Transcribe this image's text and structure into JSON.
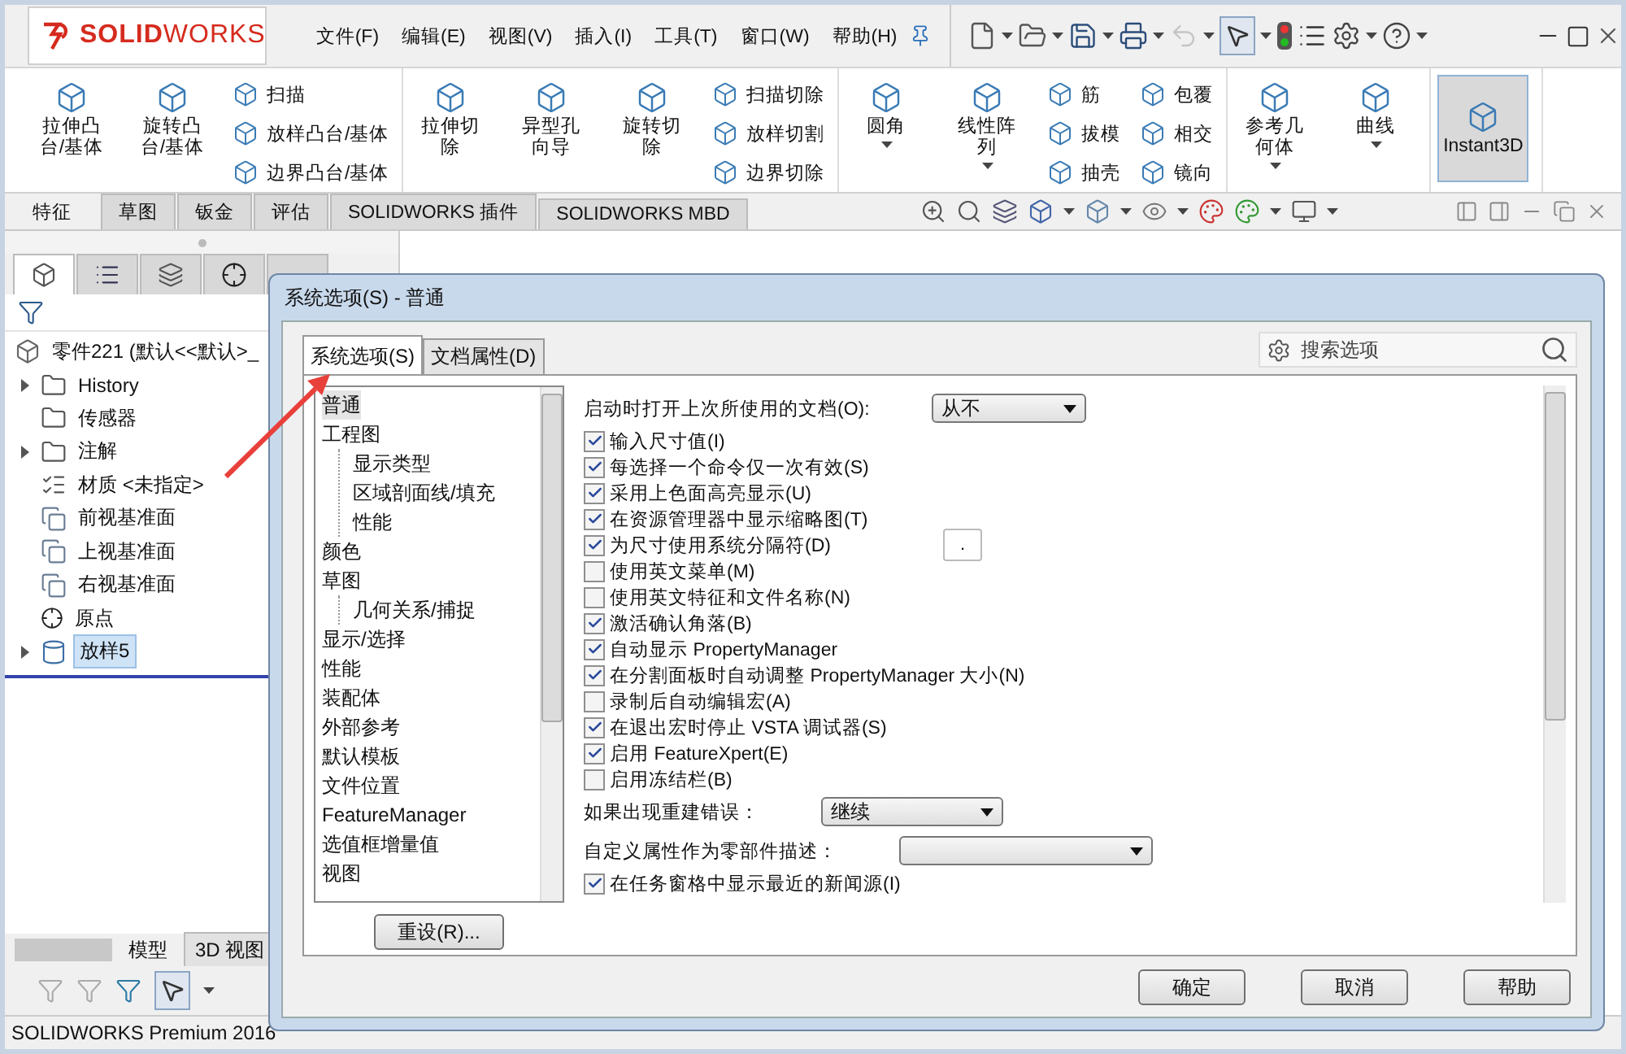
{
  "app": {
    "logo": "**SOLID**WORKS",
    "status": "SOLIDWORKS Premium 2016"
  },
  "menu": [
    "文件(F)",
    "编辑(E)",
    "视图(V)",
    "插入(I)",
    "工具(T)",
    "窗口(W)",
    "帮助(H)"
  ],
  "quick_toolbar": {
    "undo_disabled": true,
    "select_pressed": true
  },
  "ribbon": [
    {
      "big": [
        {
          "label": "拉伸凸台/基体",
          "dropdown": false,
          "pressed": false
        },
        {
          "label": "旋转凸台/基体",
          "dropdown": false,
          "pressed": false
        }
      ],
      "small_columns": [
        [
          "扫描",
          "放样凸台/基体",
          "边界凸台/基体"
        ]
      ]
    },
    {
      "big": [
        {
          "label": "拉伸切除",
          "dropdown": false,
          "pressed": false
        },
        {
          "label": "异型孔向导",
          "dropdown": false,
          "pressed": false
        },
        {
          "label": "旋转切除",
          "dropdown": false,
          "pressed": false
        }
      ],
      "small_columns": [
        [
          "扫描切除",
          "放样切割",
          "边界切除"
        ]
      ]
    },
    {
      "big": [
        {
          "label": "圆角",
          "dropdown": true,
          "pressed": false
        },
        {
          "label": "线性阵列",
          "dropdown": true,
          "pressed": false
        }
      ],
      "small_columns": [
        [
          "筋",
          "拔模",
          "抽壳"
        ],
        [
          "包覆",
          "相交",
          "镜向"
        ]
      ]
    },
    {
      "big": [
        {
          "label": "参考几何体",
          "dropdown": true,
          "pressed": false
        },
        {
          "label": "曲线",
          "dropdown": true,
          "pressed": false
        }
      ]
    },
    {
      "big": [
        {
          "label": "Instant3D",
          "dropdown": false,
          "pressed": true
        }
      ]
    }
  ],
  "command_tabs": [
    {
      "label": "特征",
      "selected": true
    },
    {
      "label": "草图",
      "selected": false
    },
    {
      "label": "钣金",
      "selected": false
    },
    {
      "label": "评估",
      "selected": false
    },
    {
      "label": "SOLIDWORKS 插件",
      "selected": false
    },
    {
      "label": "SOLIDWORKS MBD",
      "selected": false
    }
  ],
  "panel_tabs": [
    {
      "selected": true
    },
    {
      "selected": false
    },
    {
      "selected": false
    },
    {
      "selected": false
    },
    {
      "selected": false
    }
  ],
  "tree": {
    "label": "零件221  (默认<<默认>_",
    "kind": "part",
    "children": [
      {
        "label": "History",
        "kind": "history",
        "expandable": true,
        "selected": false
      },
      {
        "label": "传感器",
        "kind": "sensor",
        "expandable": false,
        "selected": false
      },
      {
        "label": "注解",
        "kind": "annotation",
        "expandable": true,
        "selected": false
      },
      {
        "label": "材质 <未指定>",
        "kind": "material",
        "expandable": false,
        "selected": false
      },
      {
        "label": "前视基准面",
        "kind": "plane",
        "expandable": false,
        "selected": false
      },
      {
        "label": "上视基准面",
        "kind": "plane",
        "expandable": false,
        "selected": false
      },
      {
        "label": "右视基准面",
        "kind": "plane",
        "expandable": false,
        "selected": false
      },
      {
        "label": "原点",
        "kind": "origin",
        "expandable": false,
        "selected": false
      },
      {
        "label": "放样5",
        "kind": "feature",
        "expandable": true,
        "selected": true
      }
    ]
  },
  "bottom_tabs": [
    {
      "label": "模型",
      "selected": true
    },
    {
      "label": "3D 视图",
      "selected": false
    }
  ],
  "filter_toolbar": {
    "select_pressed": true
  },
  "dialog": {
    "title": "系统选项(S) - 普通",
    "tabs": [
      {
        "label": "系统选项(S)",
        "selected": true
      },
      {
        "label": "文档属性(D)",
        "selected": false
      }
    ],
    "search": {
      "placeholder": "搜索选项"
    },
    "categories": [
      {
        "label": "普通",
        "selected": true
      },
      {
        "label": "工程图",
        "selected": false,
        "children": [
          {
            "label": "显示类型",
            "selected": false
          },
          {
            "label": "区域剖面线/填充",
            "selected": false
          },
          {
            "label": "性能",
            "selected": false
          }
        ]
      },
      {
        "label": "颜色",
        "selected": false
      },
      {
        "label": "草图",
        "selected": false,
        "children": [
          {
            "label": "几何关系/捕捉",
            "selected": false
          }
        ]
      },
      {
        "label": "显示/选择",
        "selected": false
      },
      {
        "label": "性能",
        "selected": false
      },
      {
        "label": "装配体",
        "selected": false
      },
      {
        "label": "外部参考",
        "selected": false
      },
      {
        "label": "默认模板",
        "selected": false
      },
      {
        "label": "文件位置",
        "selected": false
      },
      {
        "label": "FeatureManager",
        "selected": false
      },
      {
        "label": "选值框增量值",
        "selected": false
      },
      {
        "label": "视图",
        "selected": false
      }
    ],
    "reset_button": "重设(R)...",
    "options": [
      {
        "kind": "dropdown",
        "label": "启动时打开上次所使用的文档(O):",
        "value": "从不"
      },
      {
        "kind": "checkbox",
        "label": "输入尺寸值(I)",
        "checked": true
      },
      {
        "kind": "checkbox",
        "label": "每选择一个命令仅一次有效(S)",
        "checked": true
      },
      {
        "kind": "checkbox",
        "label": "采用上色面高亮显示(U)",
        "checked": true
      },
      {
        "kind": "checkbox",
        "label": "在资源管理器中显示缩略图(T)",
        "checked": true
      },
      {
        "kind": "checkbox",
        "label": "为尺寸使用系统分隔符(D)",
        "checked": true,
        "field": "."
      },
      {
        "kind": "checkbox",
        "label": "使用英文菜单(M)",
        "checked": false
      },
      {
        "kind": "checkbox",
        "label": "使用英文特征和文件名称(N)",
        "checked": false
      },
      {
        "kind": "checkbox",
        "label": "激活确认角落(B)",
        "checked": true
      },
      {
        "kind": "checkbox",
        "label": "自动显示 PropertyManager",
        "checked": true
      },
      {
        "kind": "checkbox",
        "label": "在分割面板时自动调整 PropertyManager 大小(N)",
        "checked": true
      },
      {
        "kind": "checkbox",
        "label": "录制后自动编辑宏(A)",
        "checked": false
      },
      {
        "kind": "checkbox",
        "label": "在退出宏时停止 VSTA 调试器(S)",
        "checked": true
      },
      {
        "kind": "checkbox",
        "label": "启用 FeatureXpert(E)",
        "checked": true
      },
      {
        "kind": "checkbox",
        "label": "启用冻结栏(B)",
        "checked": false
      },
      {
        "kind": "dropdown",
        "label": "如果出现重建错误：",
        "value": "继续"
      },
      {
        "kind": "dropdown",
        "label": "自定义属性作为零部件描述："
      },
      {
        "kind": "checkbox",
        "label": "在任务窗格中显示最近的新闻源(I)",
        "checked": true
      }
    ],
    "buttons": [
      "确定",
      "取消",
      "帮助"
    ]
  }
}
